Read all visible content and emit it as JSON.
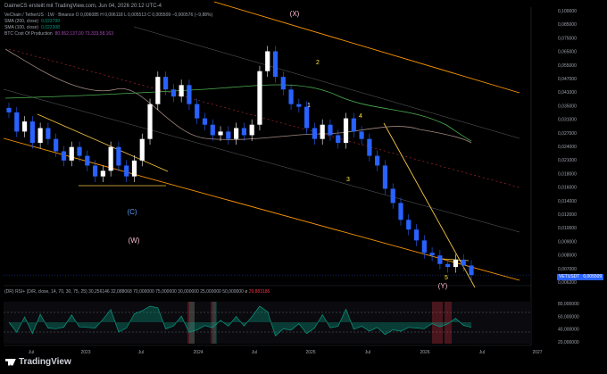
{
  "header": {
    "text": "DaimeCS ersteilt mit TradingView.com, Jun 04, 2026 20:12 UTC-4"
  },
  "legend": {
    "symbol_line": "VeChain / TetherUS · 1W · Binance  O 0,006085  H 0,006118  L 0,005513  C 0,005509  −0,000576 (−9,88%)",
    "items": [
      {
        "name": "SMA (200, close)",
        "value": "0,023799"
      },
      {
        "name": "SMA (100, close)",
        "value": "0,022308"
      },
      {
        "name": "BTC Cost Of Production",
        "value": "80.952,137,00  73.333,58,163"
      }
    ]
  },
  "rsi": {
    "label": "(DR) RSI+ (D/R, close, 14, 70, 30, 75, 25)",
    "values": "30,256146  32,088068  70,000000  75,000000  30,000000  25,000000  50,000000  ø",
    "last": "29,883186"
  },
  "price_axis": {
    "ticks": [
      "0,100000",
      "0,085000",
      "0,075000",
      "0,065000",
      "0,055000",
      "0,047000",
      "0,041000",
      "0,035000",
      "0,031000",
      "0,027000",
      "0,024000",
      "0,021000",
      "0,018000",
      "0,016000",
      "0,014000",
      "0,012000",
      "0,010000",
      "0,009000",
      "0,008000",
      "0,007000",
      "0,006200"
    ]
  },
  "rsi_axis": {
    "ticks": [
      "80,000000",
      "60,000000",
      "40,000000",
      "20,000000"
    ]
  },
  "time_axis": {
    "ticks": [
      "Jul",
      "2023",
      "Jul",
      "2024",
      "Jul",
      "2025",
      "Jul",
      "2026",
      "Jul",
      "2027"
    ]
  },
  "badges": {
    "symbol": "VETUSDT",
    "price": "0,005509"
  },
  "waves": [
    {
      "label": "(X)",
      "color": "#f8bbd0"
    },
    {
      "label": "(W)",
      "color": "#f8bbd0"
    },
    {
      "label": "(C)",
      "color": "#5b9cf6"
    },
    {
      "label": "(Y)",
      "color": "#f8bbd0"
    },
    {
      "label": "1",
      "color": "#ffffff"
    },
    {
      "label": "2",
      "color": "#ffeb3b"
    },
    {
      "label": "3",
      "color": "#ffeb3b"
    },
    {
      "label": "4",
      "color": "#ffeb3b"
    },
    {
      "label": "5",
      "color": "#ffeb3b"
    }
  ],
  "brand": "TradingView",
  "colors": {
    "up": "#ffffff",
    "down": "#2962ff",
    "sma200": "#a1887f",
    "sma100": "#4caf50",
    "channel": "#ff9800",
    "rsi_up": "#089981",
    "rsi_down": "#f23645"
  },
  "chart_data": {
    "type": "candlestick",
    "title": "VeChain / TetherUS · 1W · Binance",
    "x_range": [
      "2022-05",
      "2027-03"
    ],
    "y_scale": "log",
    "y_range": [
      0.005,
      0.1
    ],
    "series": [
      {
        "name": "VeChain / TetherUS",
        "close": [
          0.032,
          0.026,
          0.029,
          0.023,
          0.027,
          0.024,
          0.021,
          0.019,
          0.022,
          0.02,
          0.018,
          0.016,
          0.017,
          0.022,
          0.018,
          0.016,
          0.019,
          0.024,
          0.035,
          0.047,
          0.041,
          0.038,
          0.043,
          0.035,
          0.03,
          0.028,
          0.025,
          0.026,
          0.024,
          0.027,
          0.025,
          0.028,
          0.05,
          0.062,
          0.047,
          0.041,
          0.035,
          0.034,
          0.027,
          0.024,
          0.028,
          0.025,
          0.023,
          0.03,
          0.026,
          0.024,
          0.02,
          0.018,
          0.014,
          0.012,
          0.01,
          0.009,
          0.008,
          0.007,
          0.0068,
          0.0062,
          0.006,
          0.0065,
          0.0061,
          0.0055
        ]
      }
    ]
  }
}
